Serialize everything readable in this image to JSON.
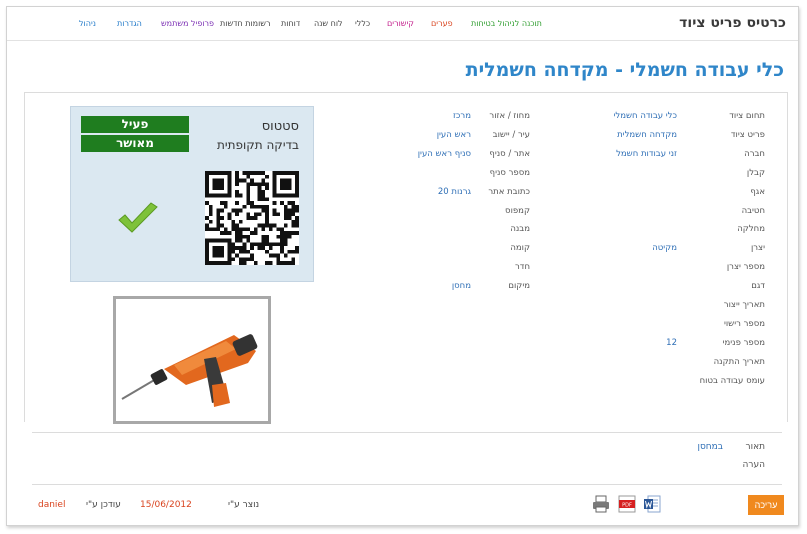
{
  "header": {
    "app_title": "כרטיס פריט ציוד"
  },
  "nav": {
    "items": [
      {
        "label": "תוכנה לניהול בטיחות",
        "color": "#2e9d2e"
      },
      {
        "label": "פערים",
        "color": "#d9441f"
      },
      {
        "label": "קישורים",
        "color": "#c21b8a"
      },
      {
        "label": "כללי",
        "color": "#444444"
      },
      {
        "label": "לוח שנה",
        "color": "#444444"
      },
      {
        "label": "דוחות",
        "color": "#444444"
      },
      {
        "label": "רשומות חדשות",
        "color": "#444444"
      },
      {
        "label": "פרופיל משתמש",
        "color": "#7a2db3"
      },
      {
        "label": "הגדרות",
        "color": "#1f78c8"
      },
      {
        "label": "ניהול",
        "color": "#1f78c8"
      }
    ]
  },
  "page": {
    "title": "כלי עבודה חשמלי - מקדחה חשמלית"
  },
  "details": {
    "col1": [
      {
        "label": "תחום ציוד",
        "value": "כלי עבודה חשמלי"
      },
      {
        "label": "פריט ציוד",
        "value": "מקדחה חשמלית"
      },
      {
        "label": "חברה",
        "value": "זני עבודות חשמל"
      },
      {
        "label": "קבלן",
        "value": ""
      },
      {
        "label": "אגף",
        "value": ""
      },
      {
        "label": "חטיבה",
        "value": ""
      },
      {
        "label": "מחלקה",
        "value": ""
      },
      {
        "label": "יצרן",
        "value": "מקיטה"
      },
      {
        "label": "מספר יצרן",
        "value": ""
      },
      {
        "label": "דגם",
        "value": ""
      },
      {
        "label": "תאריך ייצור",
        "value": ""
      },
      {
        "label": "מספר רישוי",
        "value": ""
      },
      {
        "label": "מספר פנימי",
        "value": "12"
      },
      {
        "label": "תאריך התקנה",
        "value": ""
      },
      {
        "label": "עומס עבודה בטוח",
        "value": ""
      }
    ],
    "col2": [
      {
        "label": "מחוז / אזור",
        "value": "מרכז"
      },
      {
        "label": "עיר / יישוב",
        "value": "ראש העין"
      },
      {
        "label": "אתר / סניף",
        "value": "סניף ראש העין"
      },
      {
        "label": "מספר סניף",
        "value": ""
      },
      {
        "label": "כתובת אתר",
        "value": "גרנות 20"
      },
      {
        "label": "קמפוס",
        "value": ""
      },
      {
        "label": "מבנה",
        "value": ""
      },
      {
        "label": "קומה",
        "value": ""
      },
      {
        "label": "חדר",
        "value": ""
      },
      {
        "label": "מיקום",
        "value": "מחסן"
      }
    ]
  },
  "status": {
    "title": "סטטוס",
    "periodic_check": "בדיקה תקופתית",
    "badge_active": "פעיל",
    "badge_approved": "מאושר"
  },
  "bottom": {
    "description_label": "תאור",
    "description_value": "במחסן",
    "note_label": "הערה"
  },
  "footer": {
    "created_by_label": "נוצר ע\"י",
    "updated_by_label": "עודכן ע\"י",
    "updated_date": "15/06/2012",
    "updated_by": "daniel",
    "edit_label": "עריכה",
    "pdf_label": "PDF"
  },
  "colors": {
    "accent": "#2f86c9",
    "status_green": "#1f7d1f",
    "panel_bg": "#dbe8f1",
    "edit_orange": "#f0891e",
    "link": "#2f6fb6"
  }
}
